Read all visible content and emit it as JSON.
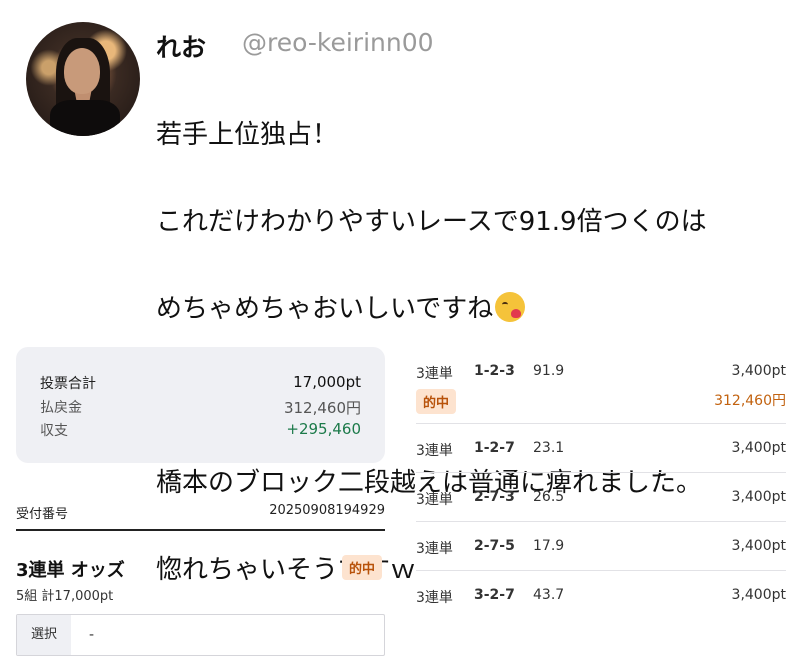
{
  "post": {
    "author_name": "れお",
    "author_handle": "@reo-keirinn00",
    "lines": [
      "若手上位独占！",
      "これだけわかりやすいレースで91.9倍つくのは",
      "めちゃめちゃおいしいですね",
      "",
      "橋本のブロック二段越えは普通に痺れました。",
      "惚れちゃいそうですｗ"
    ],
    "emoji": "kissing-face-emoji"
  },
  "summary": {
    "total_label": "投票合計",
    "total_value": "17,000pt",
    "payout_label": "払戻金",
    "payout_value": "312,460円",
    "balance_label": "収支",
    "balance_value": "+295,460"
  },
  "receipt": {
    "label": "受付番号",
    "number": "20250908194929"
  },
  "odds_section": {
    "title": "3連単 オッズ",
    "hit_badge": "的中",
    "count": "5組 計17,000pt",
    "select_label": "選択",
    "select_value": "-"
  },
  "bets": [
    {
      "type": "3連単",
      "combo": "1-2-3",
      "odds": "91.9",
      "amount": "3,400pt",
      "hit": "的中",
      "payout": "312,460円"
    },
    {
      "type": "3連単",
      "combo": "1-2-7",
      "odds": "23.1",
      "amount": "3,400pt"
    },
    {
      "type": "3連単",
      "combo": "2-7-3",
      "odds": "26.5",
      "amount": "3,400pt"
    },
    {
      "type": "3連単",
      "combo": "2-7-5",
      "odds": "17.9",
      "amount": "3,400pt"
    },
    {
      "type": "3連単",
      "combo": "3-2-7",
      "odds": "43.7",
      "amount": "3,400pt"
    }
  ],
  "colors": {
    "positive": "#1c7a4a",
    "hit_text": "#b8520a",
    "hit_bg": "#fde3cf",
    "payout": "#c2620f"
  }
}
